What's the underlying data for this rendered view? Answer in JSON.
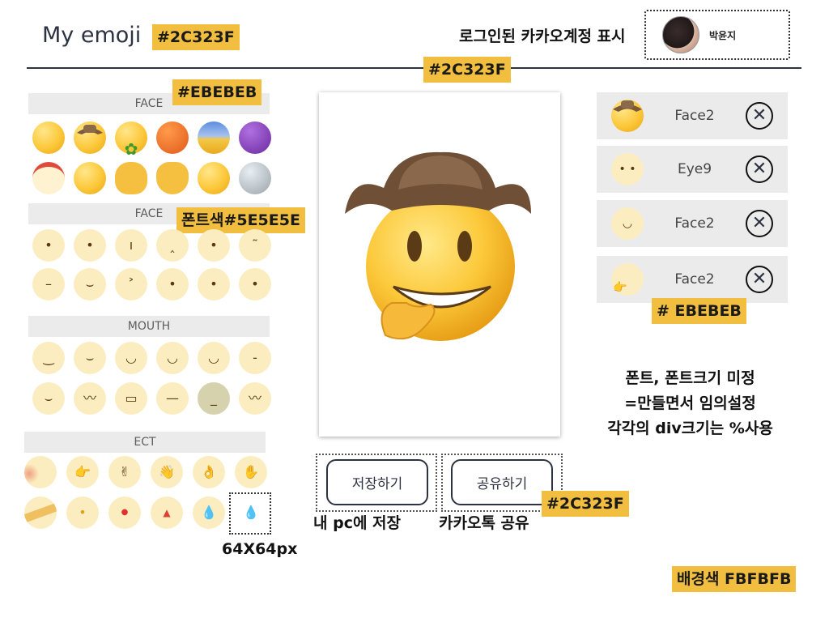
{
  "header": {
    "app_title": "My emoji",
    "account_label": "로그인된 카카오계정 표시",
    "account_name": "박윤지"
  },
  "sections": {
    "face1": "FACE",
    "face2": "FACE",
    "mouth": "MOUTH",
    "etc": "ECT"
  },
  "grid": {
    "face_eyes_row1": [
      "•",
      "•",
      "ı",
      "‸",
      "•",
      "˜"
    ],
    "face_eyes_row2": [
      "–",
      "⌣",
      "˃",
      "•",
      "•",
      "•"
    ],
    "mouth_row1": [
      "‿",
      "⌣",
      "◡",
      "◡",
      "◡",
      "-"
    ],
    "mouth_row2": [
      "⌣",
      "〰",
      "▭",
      "—",
      "_",
      "〰"
    ],
    "etc_row1": [
      "",
      "👉",
      "✌",
      "👋",
      "👌",
      "✋"
    ],
    "etc_row2": [
      "",
      "•",
      "●",
      "▲",
      "💧",
      "💧"
    ]
  },
  "layers": [
    {
      "name": "Face2",
      "delete": "✕"
    },
    {
      "name": "Eye9",
      "delete": "✕"
    },
    {
      "name": "Face2",
      "delete": "✕"
    },
    {
      "name": "Face2",
      "delete": "✕"
    }
  ],
  "actions": {
    "save_label": "저장하기",
    "save_caption": "내 pc에 저장",
    "share_label": "공유하기",
    "share_caption": "카카오톡 공유"
  },
  "annotations": {
    "title_color": "#2C323F",
    "divider_color": "#2C323F",
    "section_bg": "#EBEBEB",
    "font_color": "폰트색#5E5E5E",
    "layer_bg": "# EBEBEB",
    "button_color": "#2C323F",
    "cell_size": "64X64px",
    "font_note_1": "폰트, 폰트크기 미정",
    "font_note_2": "=만들면서 임의설정",
    "font_note_3": "각각의 div크기는 %사용",
    "bg_color": "배경색 FBFBFB"
  },
  "colors": {
    "primary": "#2C323F",
    "section_bg": "#EBEBEB",
    "section_text": "#5E5E5E",
    "page_bg": "#FBFBFB",
    "annotation": "#F2BE3F"
  }
}
